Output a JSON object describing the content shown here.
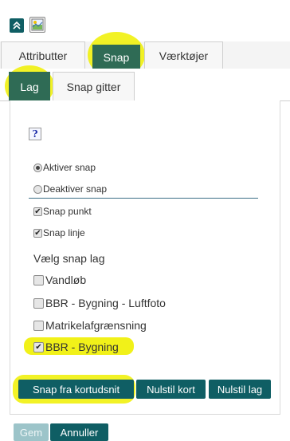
{
  "toolbar": {
    "collapse_icon": "double-chevron-up-icon",
    "map_icon": "map-image-icon"
  },
  "tabs": [
    {
      "label": "Attributter",
      "active": false
    },
    {
      "label": "Snap",
      "active": true
    },
    {
      "label": "Værktøjer",
      "active": false
    }
  ],
  "subtabs": [
    {
      "label": "Lag",
      "active": true
    },
    {
      "label": "Snap gitter",
      "active": false
    }
  ],
  "help": {
    "label": "?"
  },
  "snap_mode": [
    {
      "label": "Aktiver snap",
      "selected": true
    },
    {
      "label": "Deaktiver snap",
      "selected": false
    }
  ],
  "snap_options": [
    {
      "label": "Snap punkt",
      "checked": true
    },
    {
      "label": "Snap linje",
      "checked": true
    }
  ],
  "layers_heading": "Vælg snap lag",
  "layers": [
    {
      "label": "Vandløb",
      "checked": false
    },
    {
      "label": "BBR - Bygning - Luftfoto",
      "checked": false
    },
    {
      "label": "Matrikelafgrænsning",
      "checked": false
    },
    {
      "label": "BBR - Bygning",
      "checked": true
    }
  ],
  "actions": {
    "snap_from_extent": "Snap fra kortudsnit",
    "reset_map": "Nulstil kort",
    "reset_layer": "Nulstil lag"
  },
  "footer": {
    "save": "Gem",
    "cancel": "Annuller"
  },
  "colors": {
    "accent": "#0f5e64",
    "active_tab": "#2f6b55",
    "highlight": "#f0f000"
  }
}
